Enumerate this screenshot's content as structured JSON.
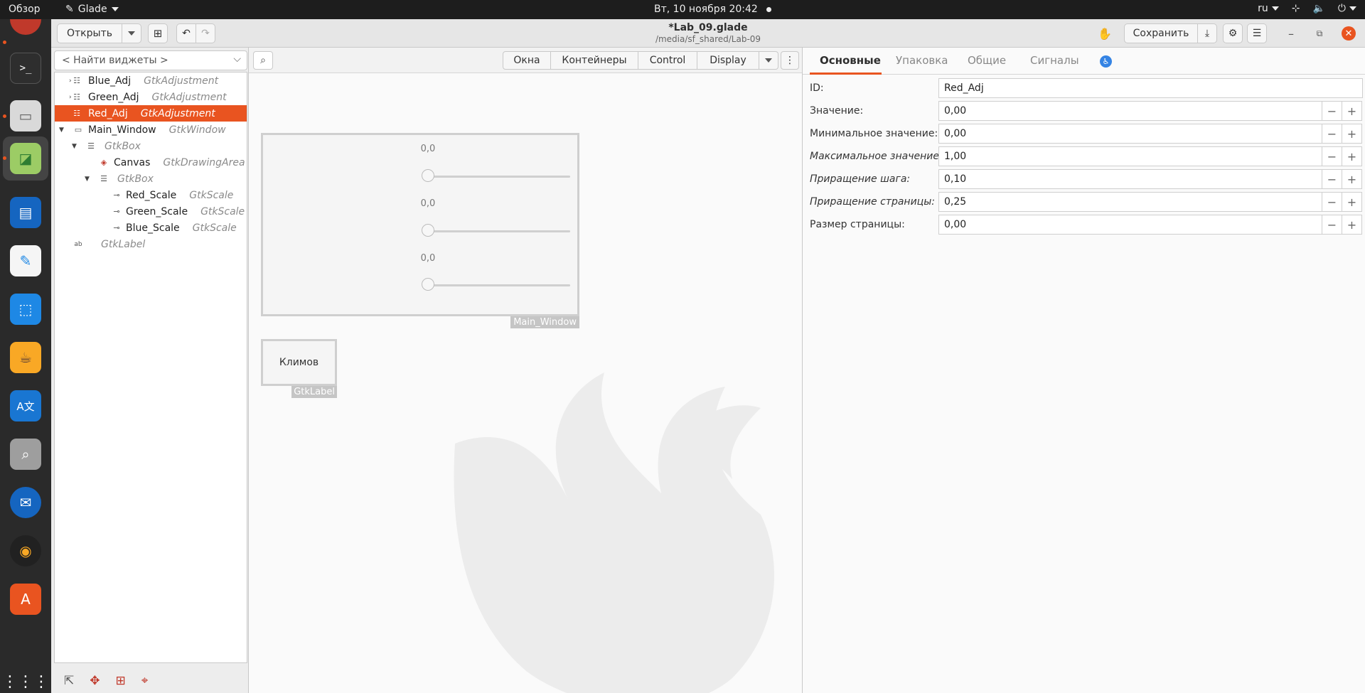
{
  "system": {
    "overview": "Обзор",
    "app_name": "Glade",
    "datetime": "Вт, 10 ноября  20:42",
    "lang": "ru"
  },
  "header": {
    "open_label": "Открыть",
    "title": "*Lab_09.glade",
    "subtitle": "/media/sf_shared/Lab-09",
    "save_label": "Сохранить"
  },
  "widgets_panel": {
    "search_placeholder": "< Найти виджеты >",
    "tree": [
      {
        "name": "Blue_Adj",
        "class": "GtkAdjustment"
      },
      {
        "name": "Green_Adj",
        "class": "GtkAdjustment"
      },
      {
        "name": "Red_Adj",
        "class": "GtkAdjustment",
        "selected": true
      },
      {
        "name": "Main_Window",
        "class": "GtkWindow"
      },
      {
        "name": "",
        "class": "GtkBox"
      },
      {
        "name": "Canvas",
        "class": "GtkDrawingArea"
      },
      {
        "name": "",
        "class": "GtkBox"
      },
      {
        "name": "Red_Scale",
        "class": "GtkScale"
      },
      {
        "name": "Green_Scale",
        "class": "GtkScale"
      },
      {
        "name": "Blue_Scale",
        "class": "GtkScale"
      },
      {
        "name": "",
        "class": "GtkLabel"
      }
    ]
  },
  "palette": {
    "segments": [
      "Окна",
      "Контейнеры",
      "Control",
      "Display"
    ]
  },
  "design": {
    "scale_values": [
      "0,0",
      "0,0",
      "0,0"
    ],
    "main_window_tag": "Main_Window",
    "label_text": "Климов",
    "label_tag": "GtkLabel"
  },
  "properties": {
    "tabs": [
      "Основные",
      "Упаковка",
      "Общие",
      "Сигналы"
    ],
    "rows": [
      {
        "label": "ID:",
        "value": "Red_Adj"
      },
      {
        "label": "Значение:",
        "value": "0,00"
      },
      {
        "label": "Минимальное значение:",
        "value": "0,00"
      },
      {
        "label": "Максимальное значение:",
        "value": "1,00"
      },
      {
        "label": "Приращение шага:",
        "value": "0,10"
      },
      {
        "label": "Приращение страницы:",
        "value": "0,25"
      },
      {
        "label": "Размер страницы:",
        "value": "0,00"
      }
    ]
  },
  "colors": {
    "accent": "#e95420",
    "topbar": "#1d1d1d",
    "dock": "#2a2a2a"
  }
}
